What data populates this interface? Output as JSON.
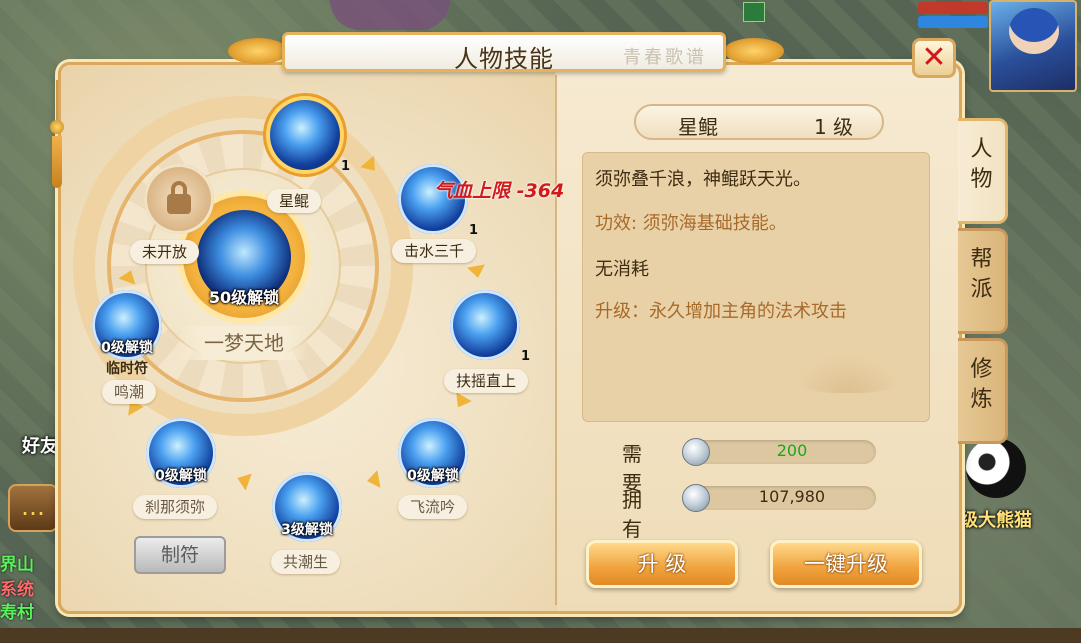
{
  "background": {
    "friend_label": "好友",
    "chat_lines": [
      {
        "text": "界山",
        "color": "#5df05d"
      },
      {
        "text": "系统",
        "color": "#ff6a6a"
      },
      {
        "text": "寿村",
        "color": "#5df05d"
      }
    ],
    "npc_label": "级大熊猫",
    "hp_color": "#c0392b",
    "mp_color": "#2e86de"
  },
  "window": {
    "title": "人物技能",
    "title_ink": "青春歌谱",
    "close_symbol": "✕"
  },
  "skill_wheel": {
    "center": {
      "name": "一梦天地",
      "lock_text": "50级解锁",
      "icon": "figure-icon"
    },
    "nodes": [
      {
        "id": "xingkun",
        "name": "星鲲",
        "level": "1",
        "lock_text": "",
        "selected": true,
        "icon": "spirit-icon"
      },
      {
        "id": "jishui",
        "name": "击水三千",
        "level": "1",
        "lock_text": "",
        "selected": false,
        "icon": "water-icon"
      },
      {
        "id": "fuyao",
        "name": "扶摇直上",
        "level": "1",
        "lock_text": "",
        "selected": false,
        "icon": "wind-icon"
      },
      {
        "id": "feiliu",
        "name": "飞流吟",
        "level": "",
        "lock_text": "0级解锁",
        "selected": false,
        "icon": "stream-icon"
      },
      {
        "id": "gongchao",
        "name": "共潮生",
        "level": "",
        "lock_text": "3级解锁",
        "selected": false,
        "icon": "tide-icon"
      },
      {
        "id": "chana",
        "name": "刹那须弥",
        "level": "",
        "lock_text": "0级解锁",
        "selected": false,
        "icon": "instant-icon"
      },
      {
        "id": "mingchao",
        "name": "鸣潮",
        "level": "",
        "lock_text": "0级解锁",
        "selected": false,
        "sub_label": "临时符",
        "icon": "shadow-icon"
      },
      {
        "id": "locked",
        "name": "未开放",
        "level": "",
        "lock_text": "",
        "selected": false,
        "icon": "padlock-icon"
      }
    ],
    "floating_text": "气血上限 -364"
  },
  "craft_button": "制符",
  "detail": {
    "skill_name": "星鲲",
    "skill_level": "1 级",
    "description": "须弥叠千浪，神鲲跃天光。",
    "effect": "功效: 须弥海基础技能。",
    "cost": "无消耗",
    "upgrade": "升级：永久增加主角的法术攻击",
    "effect_color": "#a86a2a",
    "upgrade_color": "#a86a2a"
  },
  "resources": {
    "need_label": "需要",
    "need_value": "200",
    "need_color": "#1aa81a",
    "have_label": "拥有",
    "have_value": "107,980",
    "currency_icon": "silver-coin-icon"
  },
  "buttons": {
    "upgrade": "升  级",
    "one_click": "一键升级"
  },
  "side_tabs": [
    {
      "label": "人物",
      "active": true
    },
    {
      "label": "帮派",
      "active": false
    },
    {
      "label": "修炼",
      "active": false
    }
  ]
}
